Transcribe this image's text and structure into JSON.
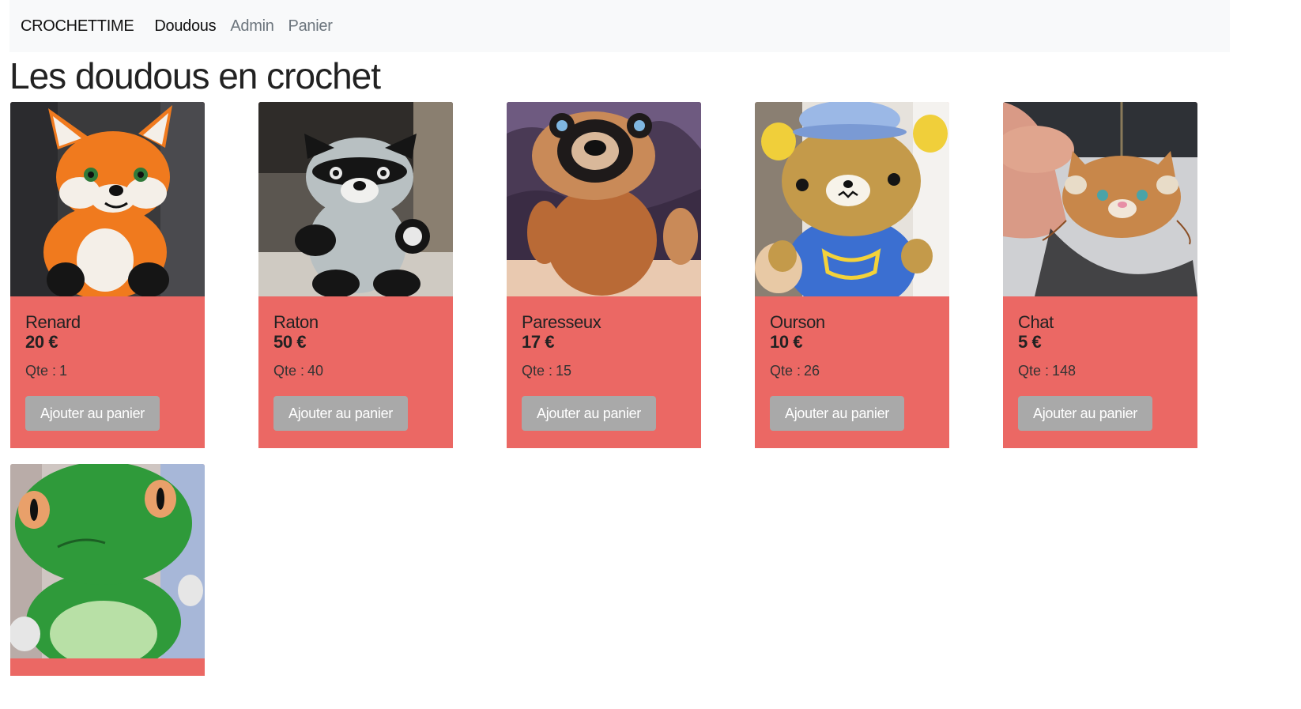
{
  "navbar": {
    "brand": "CROCHETTIME",
    "links": [
      {
        "label": "Doudous"
      },
      {
        "label": "Admin"
      },
      {
        "label": "Panier"
      }
    ]
  },
  "page_title": "Les doudous en crochet",
  "products": [
    {
      "name": "Renard",
      "price": "20 €",
      "qty_label": "Qte :",
      "qty": "1",
      "button": "Ajouter au panier",
      "image": "crochet-fox-photo"
    },
    {
      "name": "Raton",
      "price": "50 €",
      "qty_label": "Qte :",
      "qty": "40",
      "button": "Ajouter au panier",
      "image": "crochet-raccoon-photo"
    },
    {
      "name": "Paresseux",
      "price": "17 €",
      "qty_label": "Qte :",
      "qty": "15",
      "button": "Ajouter au panier",
      "image": "crochet-sloth-photo"
    },
    {
      "name": "Ourson",
      "price": "10 €",
      "qty_label": "Qte :",
      "qty": "26",
      "button": "Ajouter au panier",
      "image": "crochet-bear-photo"
    },
    {
      "name": "Chat",
      "price": "5 €",
      "qty_label": "Qte :",
      "qty": "148",
      "button": "Ajouter au panier",
      "image": "crochet-cat-keychain-photo"
    }
  ],
  "partial_product": {
    "image": "crochet-frog-photo"
  },
  "colors": {
    "navbar_bg": "#f8f9fa",
    "card_bg": "#eb6864",
    "button_bg": "#a9a9a9",
    "active_link": "#111111",
    "inactive_link": "#6c757d"
  }
}
